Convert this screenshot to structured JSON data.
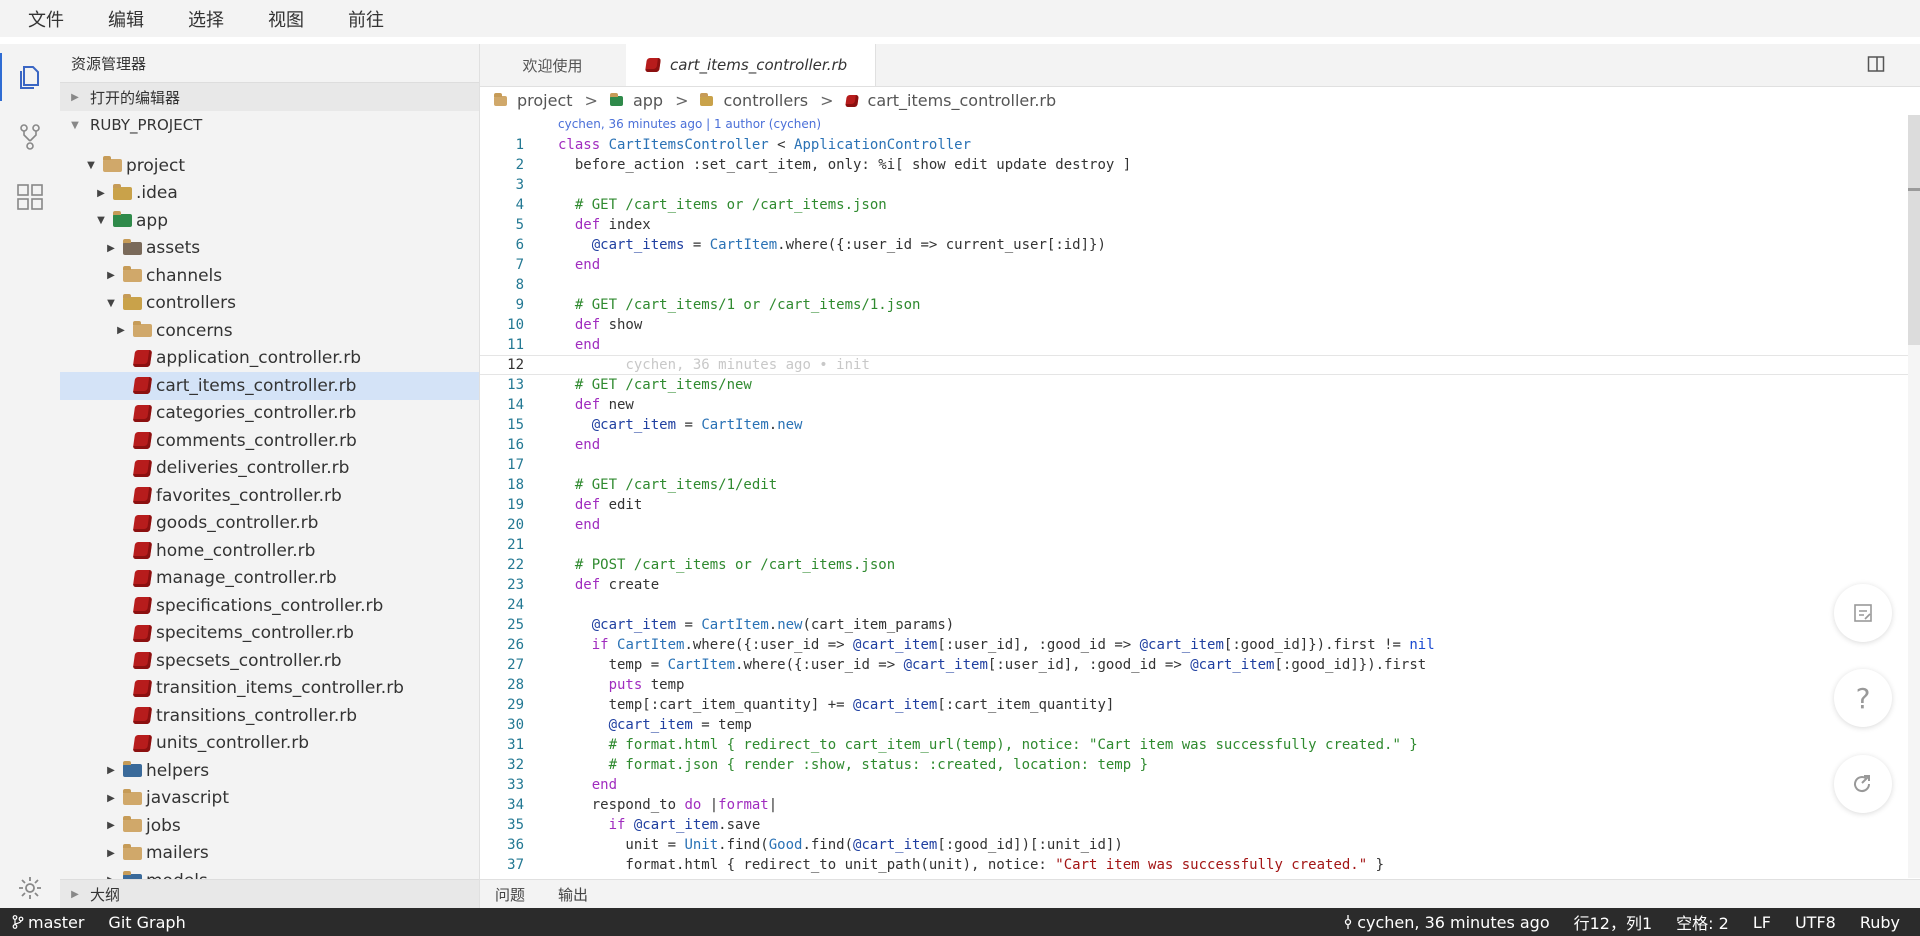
{
  "menu": [
    "文件",
    "编辑",
    "选择",
    "视图",
    "前往"
  ],
  "sidebar": {
    "title": "资源管理器",
    "open_editors": "打开的编辑器",
    "project_root": "RUBY_PROJECT",
    "outline": "大纲"
  },
  "tree": [
    {
      "label": "project",
      "depth": 1,
      "twisty": "open",
      "icon": "folder-open"
    },
    {
      "label": ".idea",
      "depth": 2,
      "twisty": "closed",
      "icon": "folder-idea"
    },
    {
      "label": "app",
      "depth": 2,
      "twisty": "open",
      "icon": "folder-app"
    },
    {
      "label": "assets",
      "depth": 3,
      "twisty": "closed",
      "icon": "folder-assets"
    },
    {
      "label": "channels",
      "depth": 3,
      "twisty": "closed",
      "icon": "folder"
    },
    {
      "label": "controllers",
      "depth": 3,
      "twisty": "open",
      "icon": "folder-controllers"
    },
    {
      "label": "concerns",
      "depth": 4,
      "twisty": "closed",
      "icon": "folder"
    },
    {
      "label": "application_controller.rb",
      "depth": 4,
      "twisty": "none",
      "icon": "ruby"
    },
    {
      "label": "cart_items_controller.rb",
      "depth": 4,
      "twisty": "none",
      "icon": "ruby",
      "selected": true
    },
    {
      "label": "categories_controller.rb",
      "depth": 4,
      "twisty": "none",
      "icon": "ruby"
    },
    {
      "label": "comments_controller.rb",
      "depth": 4,
      "twisty": "none",
      "icon": "ruby"
    },
    {
      "label": "deliveries_controller.rb",
      "depth": 4,
      "twisty": "none",
      "icon": "ruby"
    },
    {
      "label": "favorites_controller.rb",
      "depth": 4,
      "twisty": "none",
      "icon": "ruby"
    },
    {
      "label": "goods_controller.rb",
      "depth": 4,
      "twisty": "none",
      "icon": "ruby"
    },
    {
      "label": "home_controller.rb",
      "depth": 4,
      "twisty": "none",
      "icon": "ruby"
    },
    {
      "label": "manage_controller.rb",
      "depth": 4,
      "twisty": "none",
      "icon": "ruby"
    },
    {
      "label": "specifications_controller.rb",
      "depth": 4,
      "twisty": "none",
      "icon": "ruby"
    },
    {
      "label": "specitems_controller.rb",
      "depth": 4,
      "twisty": "none",
      "icon": "ruby"
    },
    {
      "label": "specsets_controller.rb",
      "depth": 4,
      "twisty": "none",
      "icon": "ruby"
    },
    {
      "label": "transition_items_controller.rb",
      "depth": 4,
      "twisty": "none",
      "icon": "ruby"
    },
    {
      "label": "transitions_controller.rb",
      "depth": 4,
      "twisty": "none",
      "icon": "ruby"
    },
    {
      "label": "units_controller.rb",
      "depth": 4,
      "twisty": "none",
      "icon": "ruby"
    },
    {
      "label": "helpers",
      "depth": 3,
      "twisty": "closed",
      "icon": "folder-helpers"
    },
    {
      "label": "javascript",
      "depth": 3,
      "twisty": "closed",
      "icon": "folder"
    },
    {
      "label": "jobs",
      "depth": 3,
      "twisty": "closed",
      "icon": "folder"
    },
    {
      "label": "mailers",
      "depth": 3,
      "twisty": "closed",
      "icon": "folder"
    },
    {
      "label": "models",
      "depth": 3,
      "twisty": "closed",
      "icon": "folder-models"
    }
  ],
  "tabs": {
    "welcome": "欢迎使用",
    "active": "cart_items_controller.rb"
  },
  "breadcrumb": [
    "project",
    "app",
    "controllers",
    "cart_items_controller.rb"
  ],
  "blame": {
    "header": "cychen, 36 minutes ago | 1 author (cychen)",
    "inline": "cychen, 36 minutes ago • init"
  },
  "code": [
    [
      [
        "kw",
        "class "
      ],
      [
        "cls",
        "CartItemsController"
      ],
      [
        "tx",
        " < "
      ],
      [
        "cls",
        "ApplicationController"
      ]
    ],
    [
      [
        "tx",
        "  before_action :set_cart_item, only: %i[ show edit update destroy ]"
      ]
    ],
    [],
    [
      [
        "cm",
        "  # GET /cart_items or /cart_items.json"
      ]
    ],
    [
      [
        "kw",
        "  def "
      ],
      [
        "tx",
        "index"
      ]
    ],
    [
      [
        "tx",
        "    "
      ],
      [
        "iv",
        "@cart_items"
      ],
      [
        "tx",
        " = "
      ],
      [
        "cls",
        "CartItem"
      ],
      [
        "tx",
        ".where({:user_id => current_user[:id]})"
      ]
    ],
    [
      [
        "kw",
        "  end"
      ]
    ],
    [],
    [
      [
        "cm",
        "  # GET /cart_items/1 or /cart_items/1.json"
      ]
    ],
    [
      [
        "kw",
        "  def "
      ],
      [
        "tx",
        "show"
      ]
    ],
    [
      [
        "kw",
        "  end"
      ]
    ],
    [],
    [
      [
        "cm",
        "  # GET /cart_items/new"
      ]
    ],
    [
      [
        "kw",
        "  def "
      ],
      [
        "tx",
        "new"
      ]
    ],
    [
      [
        "tx",
        "    "
      ],
      [
        "iv",
        "@cart_item"
      ],
      [
        "tx",
        " = "
      ],
      [
        "cls",
        "CartItem"
      ],
      [
        "tx",
        "."
      ],
      [
        "cls",
        "new"
      ]
    ],
    [
      [
        "kw",
        "  end"
      ]
    ],
    [],
    [
      [
        "cm",
        "  # GET /cart_items/1/edit"
      ]
    ],
    [
      [
        "kw",
        "  def "
      ],
      [
        "tx",
        "edit"
      ]
    ],
    [
      [
        "kw",
        "  end"
      ]
    ],
    [],
    [
      [
        "cm",
        "  # POST /cart_items or /cart_items.json"
      ]
    ],
    [
      [
        "kw",
        "  def "
      ],
      [
        "tx",
        "create"
      ]
    ],
    [],
    [
      [
        "tx",
        "    "
      ],
      [
        "iv",
        "@cart_item"
      ],
      [
        "tx",
        " = "
      ],
      [
        "cls",
        "CartItem"
      ],
      [
        "tx",
        "."
      ],
      [
        "cls",
        "new"
      ],
      [
        "tx",
        "(cart_item_params)"
      ]
    ],
    [
      [
        "kw",
        "    if "
      ],
      [
        "cls",
        "CartItem"
      ],
      [
        "tx",
        ".where({:user_id => "
      ],
      [
        "iv",
        "@cart_item"
      ],
      [
        "tx",
        "[:user_id], :good_id => "
      ],
      [
        "iv",
        "@cart_item"
      ],
      [
        "tx",
        "[:good_id]}).first != "
      ],
      [
        "nil",
        "nil"
      ]
    ],
    [
      [
        "tx",
        "      temp = "
      ],
      [
        "cls",
        "CartItem"
      ],
      [
        "tx",
        ".where({:user_id => "
      ],
      [
        "iv",
        "@cart_item"
      ],
      [
        "tx",
        "[:user_id], :good_id => "
      ],
      [
        "iv",
        "@cart_item"
      ],
      [
        "tx",
        "[:good_id]}).first"
      ]
    ],
    [
      [
        "kw",
        "      puts "
      ],
      [
        "tx",
        "temp"
      ]
    ],
    [
      [
        "tx",
        "      temp[:cart_item_quantity] += "
      ],
      [
        "iv",
        "@cart_item"
      ],
      [
        "tx",
        "[:cart_item_quantity]"
      ]
    ],
    [
      [
        "tx",
        "      "
      ],
      [
        "iv",
        "@cart_item"
      ],
      [
        "tx",
        " = temp"
      ]
    ],
    [
      [
        "cm",
        "      # format.html { redirect_to cart_item_url(temp), notice: \"Cart item was successfully created.\" }"
      ]
    ],
    [
      [
        "cm",
        "      # format.json { render :show, status: :created, location: temp }"
      ]
    ],
    [
      [
        "kw",
        "    end"
      ]
    ],
    [
      [
        "tx",
        "    respond_to "
      ],
      [
        "kw",
        "do"
      ],
      [
        "tx",
        " |"
      ],
      [
        "kw",
        "format"
      ],
      [
        "tx",
        "|"
      ]
    ],
    [
      [
        "kw",
        "      if "
      ],
      [
        "iv",
        "@cart_item"
      ],
      [
        "tx",
        ".save"
      ]
    ],
    [
      [
        "tx",
        "        unit = "
      ],
      [
        "cls",
        "Unit"
      ],
      [
        "tx",
        ".find("
      ],
      [
        "cls",
        "Good"
      ],
      [
        "tx",
        ".find("
      ],
      [
        "iv",
        "@cart_item"
      ],
      [
        "tx",
        "[:good_id])[:unit_id])"
      ]
    ],
    [
      [
        "tx",
        "        format.html { redirect_to unit_path(unit), notice: "
      ],
      [
        "str",
        "\"Cart item was successfully created.\""
      ],
      [
        "tx",
        " }"
      ]
    ]
  ],
  "current_line": 12,
  "panel": [
    "问题",
    "输出"
  ],
  "status": {
    "branch": "master",
    "git_graph": "Git Graph",
    "blame": "cychen, 36 minutes ago",
    "position": "行12，列1",
    "spaces": "空格: 2",
    "eol": "LF",
    "encoding": "UTF8",
    "language": "Ruby"
  },
  "colors": {
    "accent": "#2f6cd3",
    "selection": "#d4e3f7",
    "statusbar": "#2b2b2b",
    "ruby_icon": "#b71c1c"
  }
}
